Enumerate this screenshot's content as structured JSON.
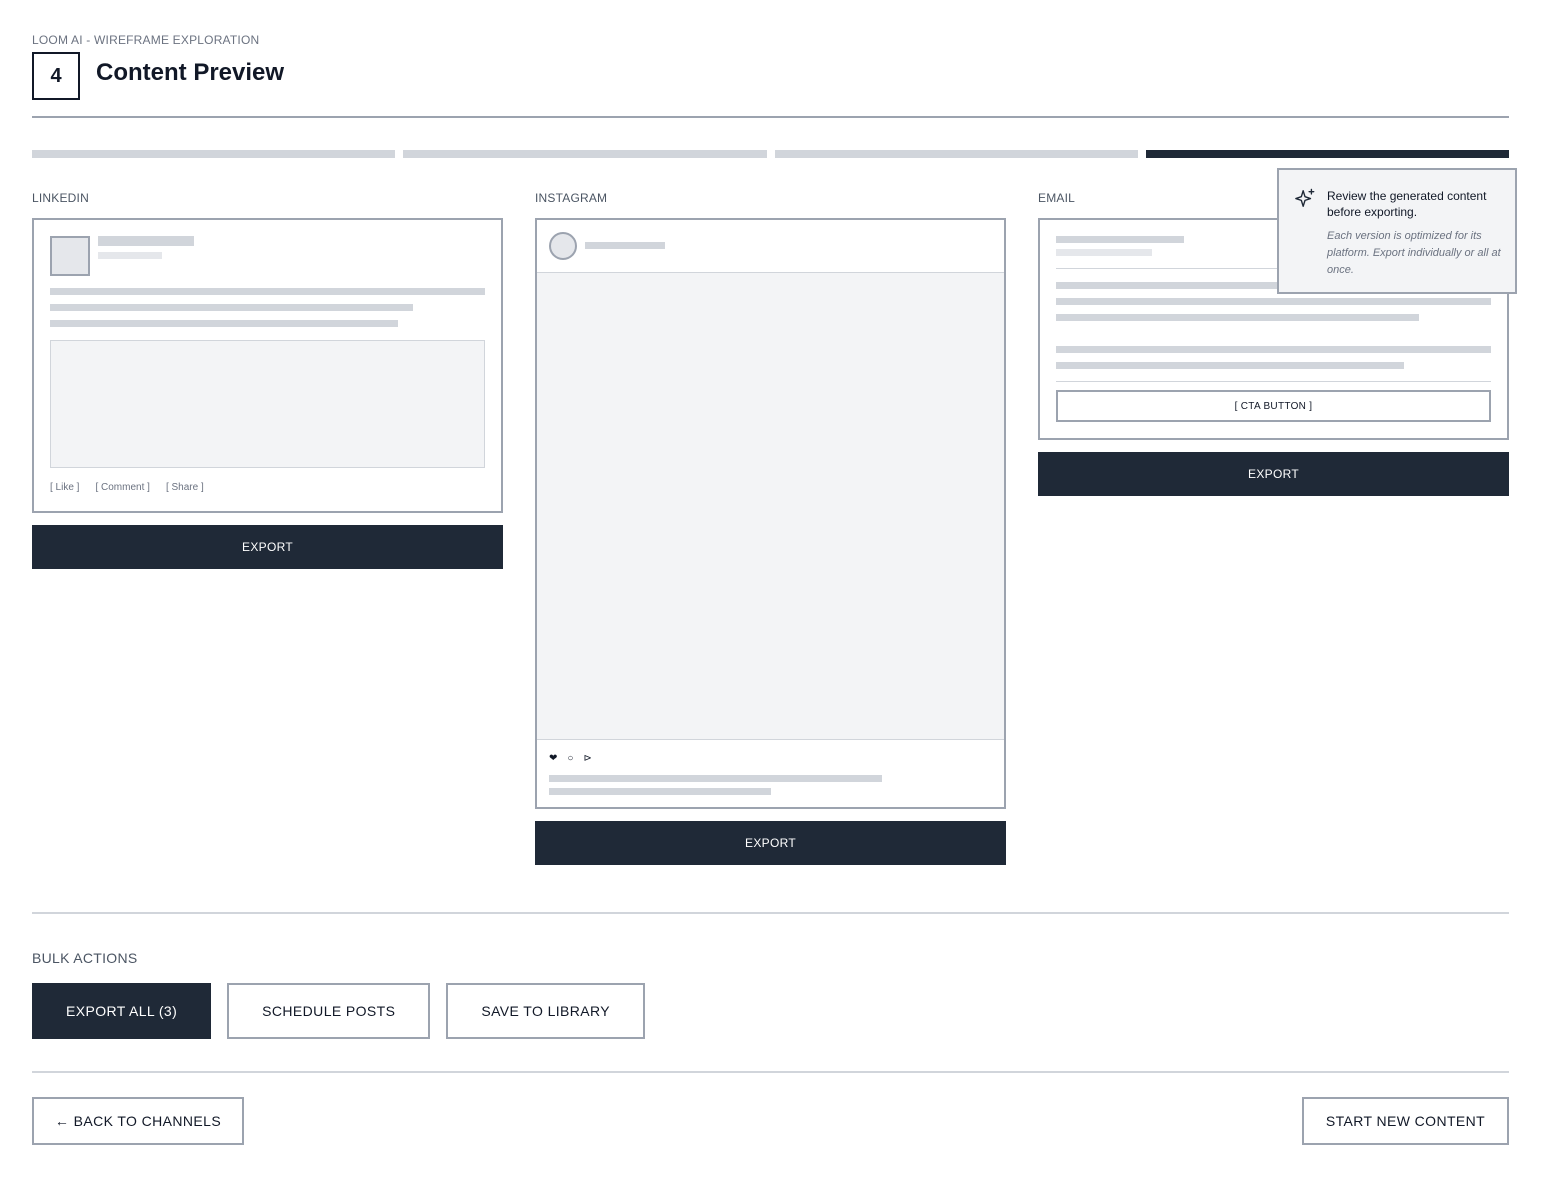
{
  "header": {
    "eyebrow": "LOOM AI - WIREFRAME EXPLORATION",
    "step_number": "4",
    "title": "Content Preview"
  },
  "progress": {
    "total_steps": 4,
    "current_step": 4
  },
  "channels": {
    "linkedin": {
      "label": "LINKEDIN",
      "actions": [
        "[ Like ]",
        "[ Comment ]",
        "[ Share ]"
      ],
      "export_label": "EXPORT"
    },
    "instagram": {
      "label": "INSTAGRAM",
      "icons": [
        "heart-icon",
        "comment-icon",
        "share-icon"
      ],
      "icon_glyphs": [
        "❤",
        "○",
        "⊳"
      ],
      "export_label": "EXPORT"
    },
    "email": {
      "label": "EMAIL",
      "cta_label": "[ CTA BUTTON ]",
      "export_label": "EXPORT"
    }
  },
  "tooltip": {
    "icon": "sparkle-icon",
    "title": "Review the generated content before exporting.",
    "body": "Each version is optimized for its platform. Export individually or all at once."
  },
  "bulk_actions": {
    "label": "BULK ACTIONS",
    "export_all": "EXPORT ALL (3)",
    "schedule": "SCHEDULE POSTS",
    "save": "SAVE TO LIBRARY"
  },
  "footer": {
    "back": "← BACK TO CHANNELS",
    "start_new": "START NEW CONTENT"
  },
  "colors": {
    "primary": "#1f2937",
    "border": "#9ca3af",
    "placeholder": "#d1d5db",
    "surface": "#f3f4f6"
  }
}
